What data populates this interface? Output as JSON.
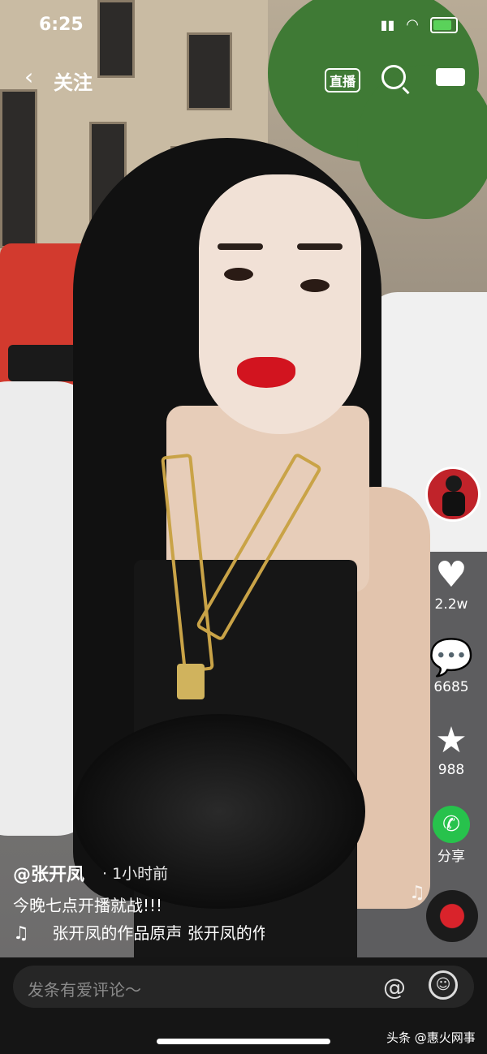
{
  "status": {
    "time": "6:25"
  },
  "nav": {
    "back_icon": "‹",
    "title": "关注",
    "live_label": "直播"
  },
  "rail": {
    "likes": "2.2w",
    "comments": "6685",
    "favorites": "988",
    "share_label": "分享"
  },
  "post": {
    "author": "@张开凤",
    "time_ago": "· 1小时前",
    "caption": "今晚七点开播就战!!!",
    "sound": "张开凤的作品原声 张开凤的作品原声"
  },
  "comment": {
    "placeholder": "发条有爱评论～"
  },
  "watermark": "头条 @惠火网事",
  "colors": {
    "like": "#ffffff",
    "share_green": "#27c24c",
    "accent_red": "#d2141f"
  },
  "icons": [
    "back-icon",
    "live-icon",
    "search-icon",
    "camera-icon",
    "heart-icon",
    "comment-icon",
    "star-icon",
    "wechat-icon",
    "music-note-icon",
    "at-icon",
    "emoji-icon"
  ]
}
